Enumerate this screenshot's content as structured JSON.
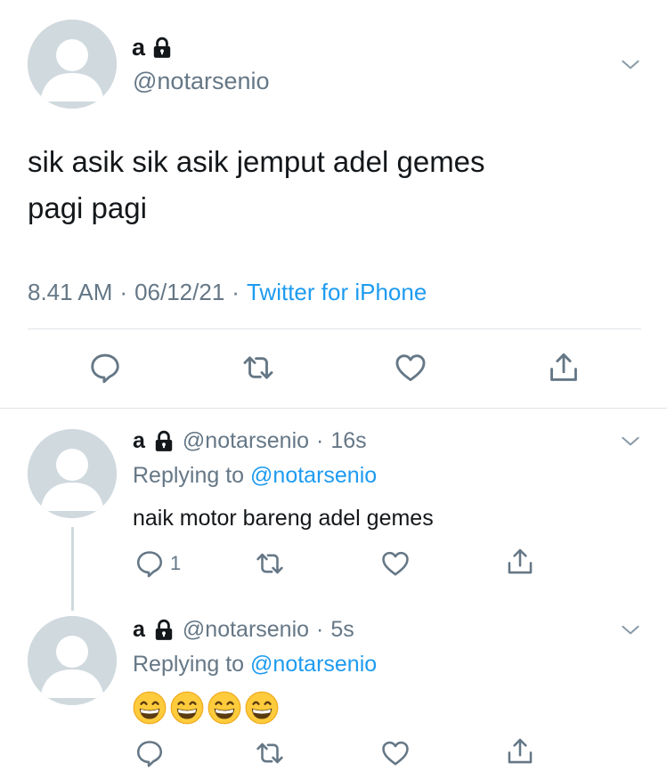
{
  "tweet": {
    "name": "a",
    "handle": "@notarsenio",
    "text_line1": "sik asik sik asik jemput adel gemes",
    "text_line2": "pagi pagi",
    "time": "8.41 AM",
    "sep1": "·",
    "date": "06/12/21",
    "sep2": "·",
    "source": "Twitter for iPhone",
    "icons": [
      "reply-icon",
      "retweet-icon",
      "like-icon",
      "share-icon"
    ]
  },
  "replies": [
    {
      "name": "a",
      "handle": "@notarsenio",
      "sep": "·",
      "age": "16s",
      "replying_label": "Replying to",
      "replying_to": "@notarsenio",
      "text": "naik motor bareng adel gemes",
      "reply_count": "1"
    },
    {
      "name": "a",
      "handle": "@notarsenio",
      "sep": "·",
      "age": "5s",
      "replying_label": "Replying to",
      "replying_to": "@notarsenio",
      "emojis": [
        "grinning-face",
        "grinning-face",
        "grinning-face",
        "grinning-face"
      ]
    }
  ],
  "colors": {
    "text": "#14171a",
    "muted": "#657786",
    "link": "#1d9bf0",
    "avatar": "#cfd9de",
    "divider": "#dfe4e8"
  }
}
